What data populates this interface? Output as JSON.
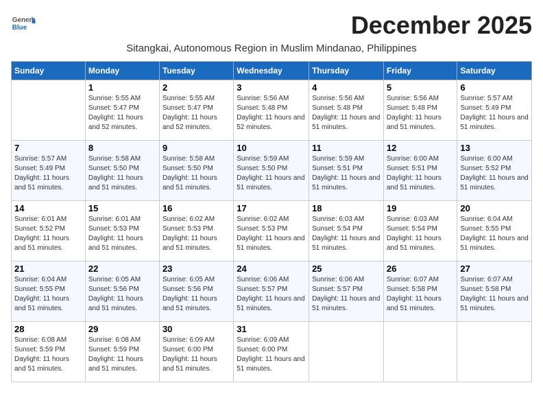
{
  "logo": {
    "general": "General",
    "blue": "Blue"
  },
  "title": "December 2025",
  "subtitle": "Sitangkai, Autonomous Region in Muslim Mindanao, Philippines",
  "headers": [
    "Sunday",
    "Monday",
    "Tuesday",
    "Wednesday",
    "Thursday",
    "Friday",
    "Saturday"
  ],
  "weeks": [
    [
      {
        "day": "",
        "sunrise": "",
        "sunset": "",
        "daylight": ""
      },
      {
        "day": "1",
        "sunrise": "Sunrise: 5:55 AM",
        "sunset": "Sunset: 5:47 PM",
        "daylight": "Daylight: 11 hours and 52 minutes."
      },
      {
        "day": "2",
        "sunrise": "Sunrise: 5:55 AM",
        "sunset": "Sunset: 5:47 PM",
        "daylight": "Daylight: 11 hours and 52 minutes."
      },
      {
        "day": "3",
        "sunrise": "Sunrise: 5:56 AM",
        "sunset": "Sunset: 5:48 PM",
        "daylight": "Daylight: 11 hours and 52 minutes."
      },
      {
        "day": "4",
        "sunrise": "Sunrise: 5:56 AM",
        "sunset": "Sunset: 5:48 PM",
        "daylight": "Daylight: 11 hours and 51 minutes."
      },
      {
        "day": "5",
        "sunrise": "Sunrise: 5:56 AM",
        "sunset": "Sunset: 5:48 PM",
        "daylight": "Daylight: 11 hours and 51 minutes."
      },
      {
        "day": "6",
        "sunrise": "Sunrise: 5:57 AM",
        "sunset": "Sunset: 5:49 PM",
        "daylight": "Daylight: 11 hours and 51 minutes."
      }
    ],
    [
      {
        "day": "7",
        "sunrise": "Sunrise: 5:57 AM",
        "sunset": "Sunset: 5:49 PM",
        "daylight": "Daylight: 11 hours and 51 minutes."
      },
      {
        "day": "8",
        "sunrise": "Sunrise: 5:58 AM",
        "sunset": "Sunset: 5:50 PM",
        "daylight": "Daylight: 11 hours and 51 minutes."
      },
      {
        "day": "9",
        "sunrise": "Sunrise: 5:58 AM",
        "sunset": "Sunset: 5:50 PM",
        "daylight": "Daylight: 11 hours and 51 minutes."
      },
      {
        "day": "10",
        "sunrise": "Sunrise: 5:59 AM",
        "sunset": "Sunset: 5:50 PM",
        "daylight": "Daylight: 11 hours and 51 minutes."
      },
      {
        "day": "11",
        "sunrise": "Sunrise: 5:59 AM",
        "sunset": "Sunset: 5:51 PM",
        "daylight": "Daylight: 11 hours and 51 minutes."
      },
      {
        "day": "12",
        "sunrise": "Sunrise: 6:00 AM",
        "sunset": "Sunset: 5:51 PM",
        "daylight": "Daylight: 11 hours and 51 minutes."
      },
      {
        "day": "13",
        "sunrise": "Sunrise: 6:00 AM",
        "sunset": "Sunset: 5:52 PM",
        "daylight": "Daylight: 11 hours and 51 minutes."
      }
    ],
    [
      {
        "day": "14",
        "sunrise": "Sunrise: 6:01 AM",
        "sunset": "Sunset: 5:52 PM",
        "daylight": "Daylight: 11 hours and 51 minutes."
      },
      {
        "day": "15",
        "sunrise": "Sunrise: 6:01 AM",
        "sunset": "Sunset: 5:53 PM",
        "daylight": "Daylight: 11 hours and 51 minutes."
      },
      {
        "day": "16",
        "sunrise": "Sunrise: 6:02 AM",
        "sunset": "Sunset: 5:53 PM",
        "daylight": "Daylight: 11 hours and 51 minutes."
      },
      {
        "day": "17",
        "sunrise": "Sunrise: 6:02 AM",
        "sunset": "Sunset: 5:53 PM",
        "daylight": "Daylight: 11 hours and 51 minutes."
      },
      {
        "day": "18",
        "sunrise": "Sunrise: 6:03 AM",
        "sunset": "Sunset: 5:54 PM",
        "daylight": "Daylight: 11 hours and 51 minutes."
      },
      {
        "day": "19",
        "sunrise": "Sunrise: 6:03 AM",
        "sunset": "Sunset: 5:54 PM",
        "daylight": "Daylight: 11 hours and 51 minutes."
      },
      {
        "day": "20",
        "sunrise": "Sunrise: 6:04 AM",
        "sunset": "Sunset: 5:55 PM",
        "daylight": "Daylight: 11 hours and 51 minutes."
      }
    ],
    [
      {
        "day": "21",
        "sunrise": "Sunrise: 6:04 AM",
        "sunset": "Sunset: 5:55 PM",
        "daylight": "Daylight: 11 hours and 51 minutes."
      },
      {
        "day": "22",
        "sunrise": "Sunrise: 6:05 AM",
        "sunset": "Sunset: 5:56 PM",
        "daylight": "Daylight: 11 hours and 51 minutes."
      },
      {
        "day": "23",
        "sunrise": "Sunrise: 6:05 AM",
        "sunset": "Sunset: 5:56 PM",
        "daylight": "Daylight: 11 hours and 51 minutes."
      },
      {
        "day": "24",
        "sunrise": "Sunrise: 6:06 AM",
        "sunset": "Sunset: 5:57 PM",
        "daylight": "Daylight: 11 hours and 51 minutes."
      },
      {
        "day": "25",
        "sunrise": "Sunrise: 6:06 AM",
        "sunset": "Sunset: 5:57 PM",
        "daylight": "Daylight: 11 hours and 51 minutes."
      },
      {
        "day": "26",
        "sunrise": "Sunrise: 6:07 AM",
        "sunset": "Sunset: 5:58 PM",
        "daylight": "Daylight: 11 hours and 51 minutes."
      },
      {
        "day": "27",
        "sunrise": "Sunrise: 6:07 AM",
        "sunset": "Sunset: 5:58 PM",
        "daylight": "Daylight: 11 hours and 51 minutes."
      }
    ],
    [
      {
        "day": "28",
        "sunrise": "Sunrise: 6:08 AM",
        "sunset": "Sunset: 5:59 PM",
        "daylight": "Daylight: 11 hours and 51 minutes."
      },
      {
        "day": "29",
        "sunrise": "Sunrise: 6:08 AM",
        "sunset": "Sunset: 5:59 PM",
        "daylight": "Daylight: 11 hours and 51 minutes."
      },
      {
        "day": "30",
        "sunrise": "Sunrise: 6:09 AM",
        "sunset": "Sunset: 6:00 PM",
        "daylight": "Daylight: 11 hours and 51 minutes."
      },
      {
        "day": "31",
        "sunrise": "Sunrise: 6:09 AM",
        "sunset": "Sunset: 6:00 PM",
        "daylight": "Daylight: 11 hours and 51 minutes."
      },
      {
        "day": "",
        "sunrise": "",
        "sunset": "",
        "daylight": ""
      },
      {
        "day": "",
        "sunrise": "",
        "sunset": "",
        "daylight": ""
      },
      {
        "day": "",
        "sunrise": "",
        "sunset": "",
        "daylight": ""
      }
    ]
  ]
}
